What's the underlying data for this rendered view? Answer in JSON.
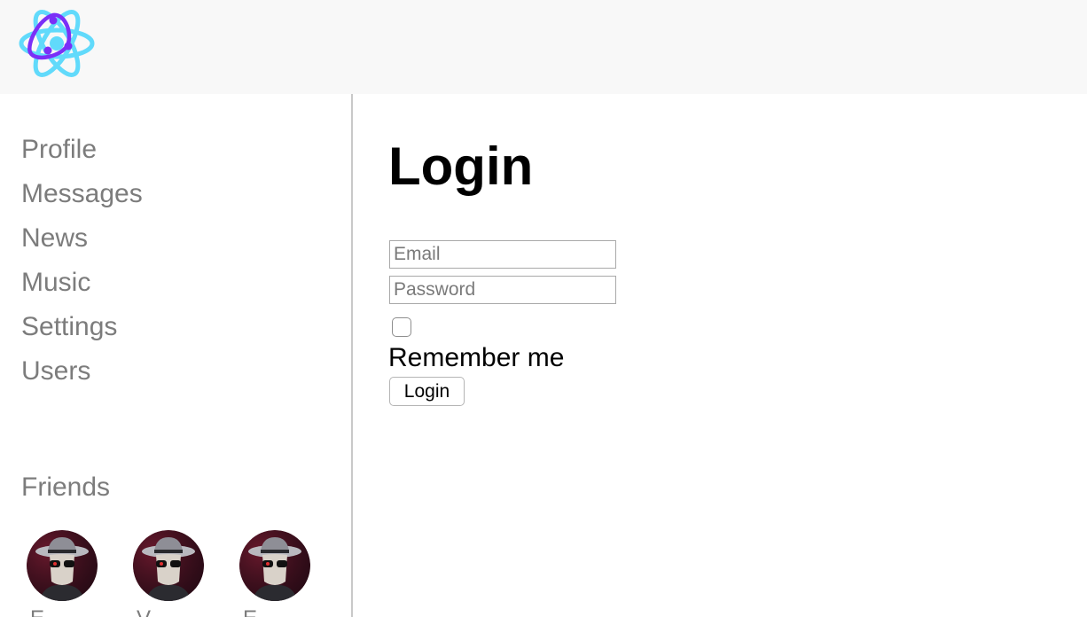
{
  "header": {
    "logo_icon": "react-atom-logo-icon",
    "logo_colors": {
      "ring": "#61dafb",
      "core": "#7b2ff7"
    }
  },
  "sidebar": {
    "nav": [
      {
        "label": "Profile"
      },
      {
        "label": "Messages"
      },
      {
        "label": "News"
      },
      {
        "label": "Music"
      },
      {
        "label": "Settings"
      },
      {
        "label": "Users"
      }
    ],
    "friends_title": "Friends",
    "friends": [
      {
        "name": "E",
        "avatar_icon": "spy-avatar-icon"
      },
      {
        "name": "V",
        "avatar_icon": "spy-avatar-icon"
      },
      {
        "name": "E",
        "avatar_icon": "spy-avatar-icon"
      }
    ]
  },
  "login": {
    "title": "Login",
    "email": {
      "value": "",
      "placeholder": "Email"
    },
    "password": {
      "value": "",
      "placeholder": "Password"
    },
    "remember_checked": false,
    "remember_label": "Remember me",
    "submit_label": "Login"
  }
}
